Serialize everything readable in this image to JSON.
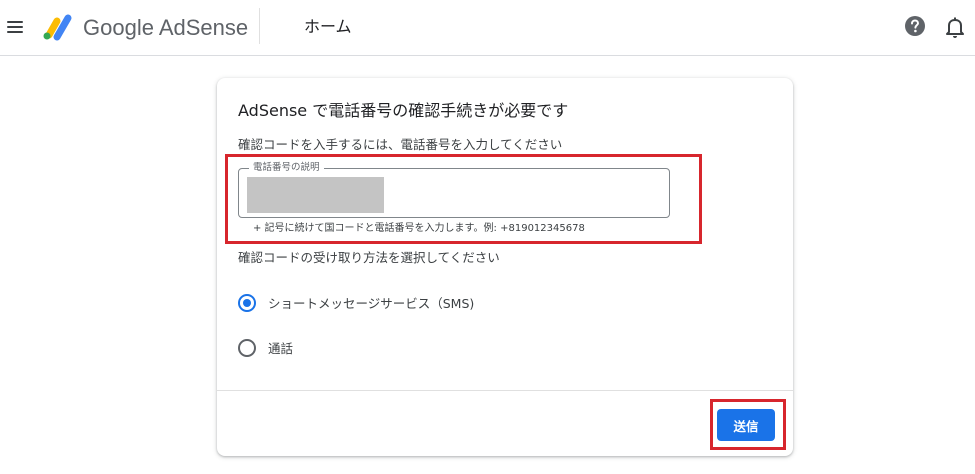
{
  "header": {
    "menu_icon": "hamburger-menu-icon",
    "product_name": "Google AdSense",
    "page_title": "ホーム",
    "help_icon": "help-circle-icon",
    "notifications_icon": "bell-icon"
  },
  "card": {
    "title": "AdSense で電話番号の確認手続きが必要です",
    "subtitle": "確認コードを入手するには、電話番号を入力してください",
    "phone_field": {
      "label": "電話番号の説明",
      "value": "",
      "hint": "+ 記号に続けて国コードと電話番号を入力します。例: +819012345678"
    },
    "method_title": "確認コードの受け取り方法を選択してください",
    "methods": [
      {
        "label": "ショートメッセージサービス（SMS)",
        "selected": true
      },
      {
        "label": "通話",
        "selected": false
      }
    ],
    "submit_label": "送信"
  },
  "colors": {
    "accent": "#1a73e8",
    "highlight": "#d7262d"
  }
}
